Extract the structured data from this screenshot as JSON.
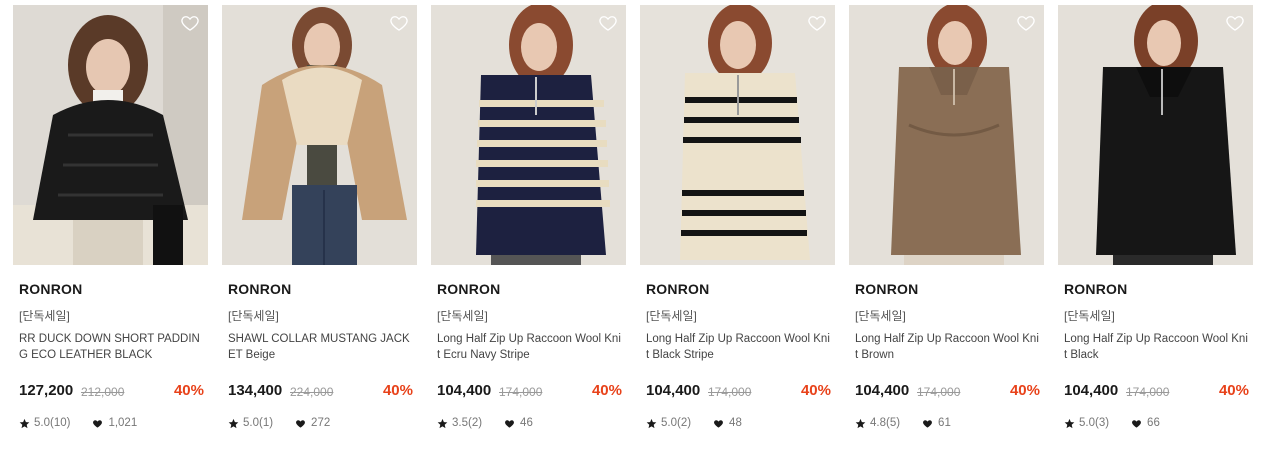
{
  "colors": {
    "discount": "#e8421a",
    "text": "#1a1a1a"
  },
  "icons": {
    "wishlist": "heart-outline-icon",
    "rating": "star-icon",
    "likes": "heart-filled-icon"
  },
  "products": [
    {
      "brand": "RONRON",
      "tag": "[단독세일]",
      "name": "RR DUCK DOWN SHORT PADDING ECO LEATHER BLACK",
      "price": "127,200",
      "original_price": "212,000",
      "discount": "40%",
      "rating": "5.0(10)",
      "likes": "1,021"
    },
    {
      "brand": "RONRON",
      "tag": "[단독세일]",
      "name": "SHAWL COLLAR MUSTANG JACKET Beige",
      "price": "134,400",
      "original_price": "224,000",
      "discount": "40%",
      "rating": "5.0(1)",
      "likes": "272"
    },
    {
      "brand": "RONRON",
      "tag": "[단독세일]",
      "name": "Long Half Zip Up Raccoon Wool Knit Ecru Navy Stripe",
      "price": "104,400",
      "original_price": "174,000",
      "discount": "40%",
      "rating": "3.5(2)",
      "likes": "46"
    },
    {
      "brand": "RONRON",
      "tag": "[단독세일]",
      "name": "Long Half Zip Up Raccoon Wool Knit Black Stripe",
      "price": "104,400",
      "original_price": "174,000",
      "discount": "40%",
      "rating": "5.0(2)",
      "likes": "48"
    },
    {
      "brand": "RONRON",
      "tag": "[단독세일]",
      "name": "Long Half Zip Up Raccoon Wool Knit Brown",
      "price": "104,400",
      "original_price": "174,000",
      "discount": "40%",
      "rating": "4.8(5)",
      "likes": "61"
    },
    {
      "brand": "RONRON",
      "tag": "[단독세일]",
      "name": "Long Half Zip Up Raccoon Wool Knit Black",
      "price": "104,400",
      "original_price": "174,000",
      "discount": "40%",
      "rating": "5.0(3)",
      "likes": "66"
    }
  ]
}
